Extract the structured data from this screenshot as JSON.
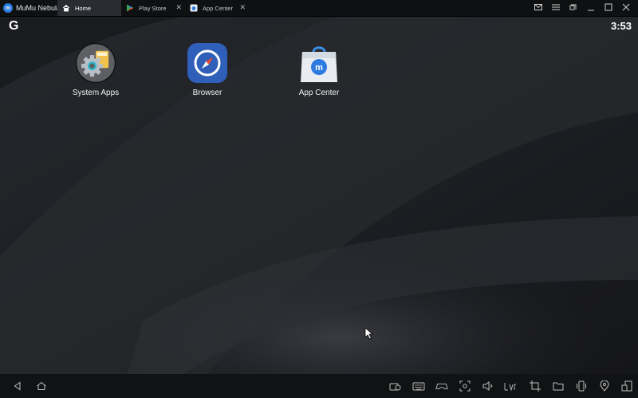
{
  "window": {
    "app_name": "MuMu Nebula",
    "tabs": [
      {
        "label": "Home",
        "active": true
      },
      {
        "label": "Play Store",
        "active": false
      },
      {
        "label": "App Center",
        "active": false
      }
    ]
  },
  "statusbar": {
    "left_glyph": "G",
    "time": "3:53"
  },
  "home_apps": [
    {
      "label": "System Apps",
      "icon": "gear-icon"
    },
    {
      "label": "Browser",
      "icon": "compass-icon"
    },
    {
      "label": "App Center",
      "icon": "shopping-bag-icon"
    }
  ],
  "colors": {
    "titlebar": "#0f1012",
    "active_tab": "#2a2c31",
    "screen_bg": "#1c1d21",
    "brand_blue": "#2b7be0",
    "browser_blue": "#2f5fb8"
  }
}
